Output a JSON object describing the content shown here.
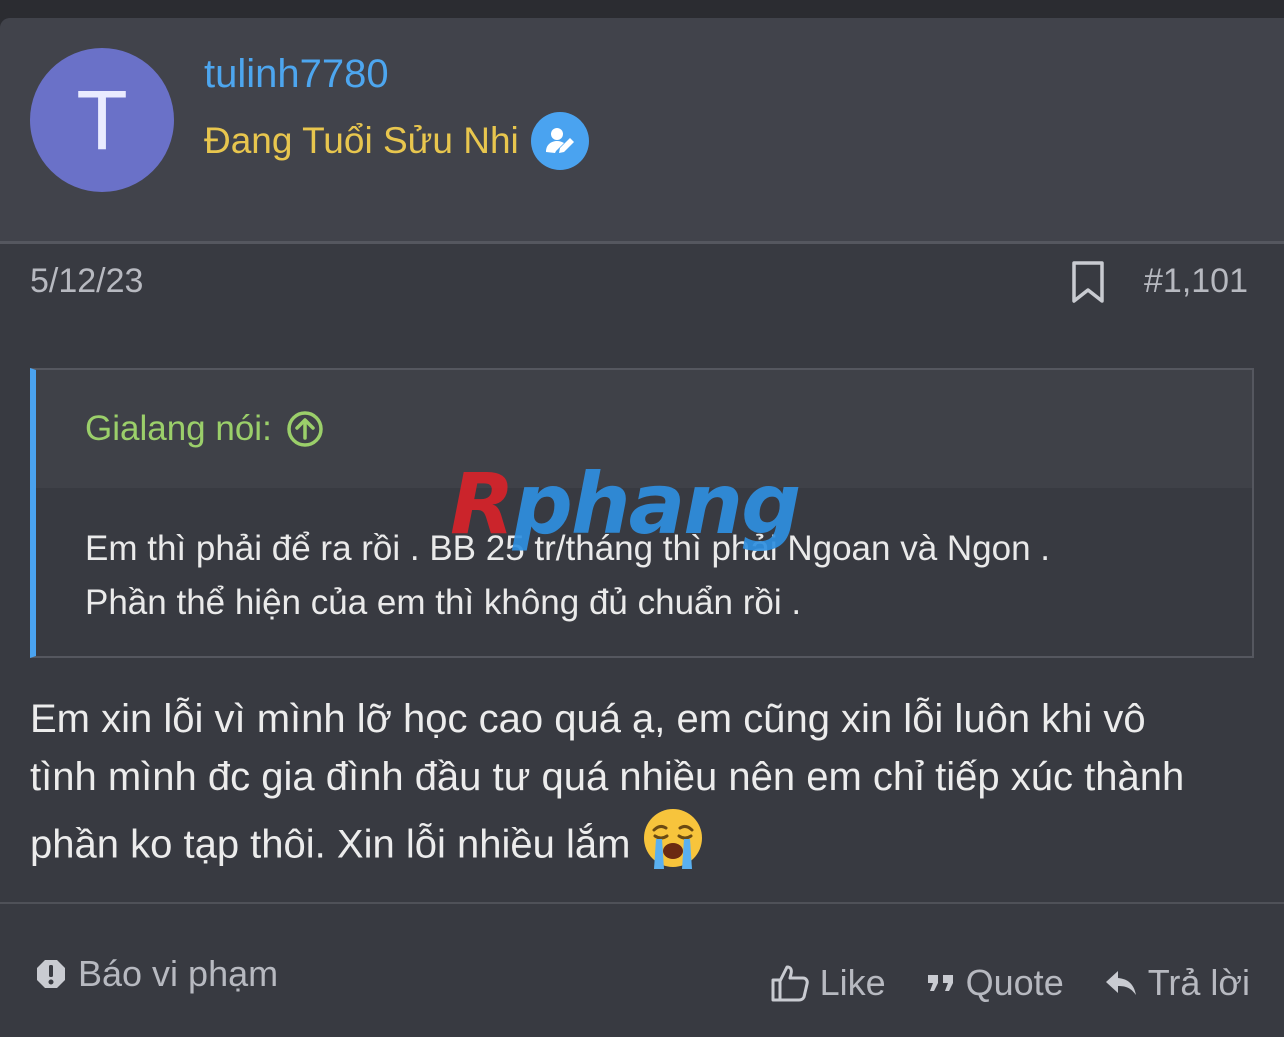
{
  "user": {
    "avatar_letter": "T",
    "username": "tulinh7780",
    "title": "Đang Tuổi Sửu Nhi"
  },
  "post": {
    "date": "5/12/23",
    "number": "#1,101"
  },
  "quote": {
    "author_label": "Gialang nói:",
    "lines": [
      "Em thì phải để ra rồi . BB 25 tr/tháng thì phải Ngoan và Ngon .",
      "Phần thể hiện của em thì không đủ chuẩn rồi ."
    ]
  },
  "watermark": {
    "first": "R",
    "rest": "phang"
  },
  "message": {
    "lines": [
      "Em xin lỗi vì mình lỡ học cao quá ạ, em cũng xin lỗi luôn khi vô",
      "tình mình đc gia đình đầu tư quá nhiều nên em chỉ tiếp xúc thành",
      "phần ko tạp thôi. Xin lỗi nhiều lắm"
    ]
  },
  "footer": {
    "report_label": "Báo vi phạm",
    "like_label": "Like",
    "quote_label": "Quote",
    "reply_label": "Trả lời"
  },
  "colors": {
    "username": "#4da6ef",
    "user_title": "#e8c64e",
    "quote_author": "#9bcf6a",
    "accent": "#4aa3f0"
  }
}
